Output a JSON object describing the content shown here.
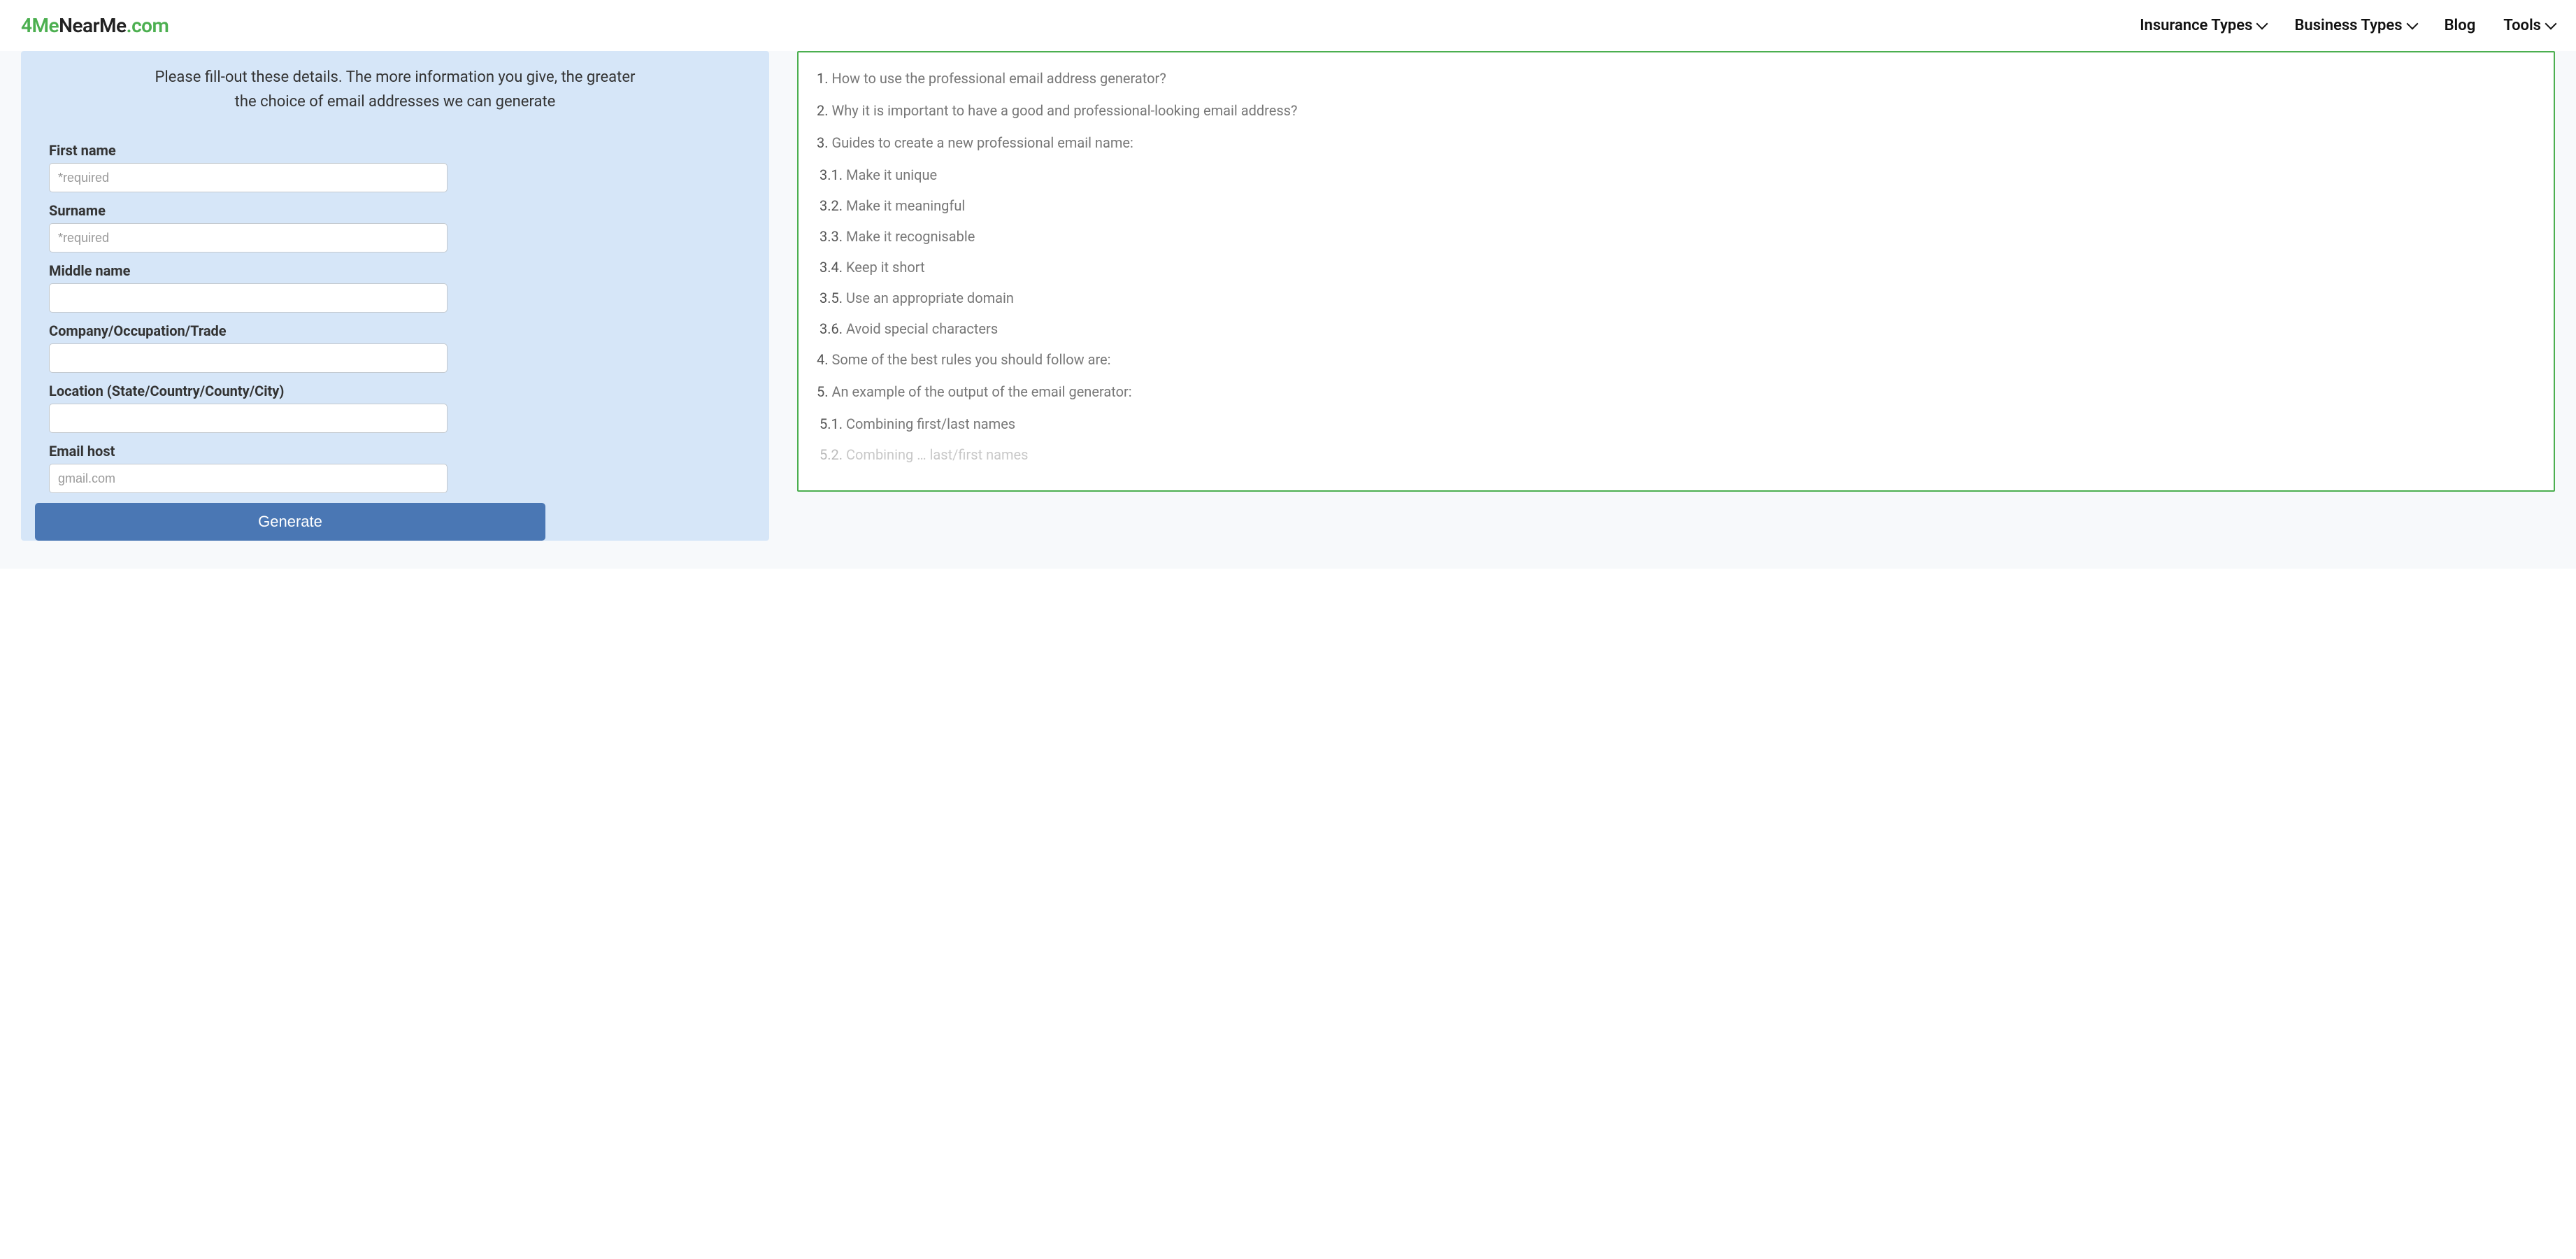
{
  "logo": {
    "part1": "4Me",
    "part2": "NearMe",
    "part3": ".com"
  },
  "nav": {
    "insurance": "Insurance Types",
    "business": "Business Types",
    "blog": "Blog",
    "tools": "Tools"
  },
  "form": {
    "intro": "Please fill-out these details. The more information you give, the greater the choice of email addresses we can generate",
    "firstname_label": "First name",
    "firstname_placeholder": "*required",
    "surname_label": "Surname",
    "surname_placeholder": "*required",
    "middlename_label": "Middle name",
    "company_label": "Company/Occupation/Trade",
    "location_label": "Location (State/Country/County/City)",
    "emailhost_label": "Email host",
    "emailhost_placeholder": "gmail.com",
    "generate_btn": "Generate"
  },
  "toc": {
    "i1": {
      "num": "1.",
      "text": " How to use the professional email address generator?"
    },
    "i2": {
      "num": "2.",
      "text": " Why it is important to have a good and professional-looking email address?"
    },
    "i3": {
      "num": "3.",
      "text": " Guides to create a new professional email name:"
    },
    "i3_1": {
      "num": "3.1.",
      "text": " Make it unique"
    },
    "i3_2": {
      "num": "3.2.",
      "text": " Make it meaningful"
    },
    "i3_3": {
      "num": "3.3.",
      "text": " Make it recognisable"
    },
    "i3_4": {
      "num": "3.4.",
      "text": " Keep it short"
    },
    "i3_5": {
      "num": "3.5.",
      "text": " Use an appropriate domain"
    },
    "i3_6": {
      "num": "3.6.",
      "text": " Avoid special characters"
    },
    "i4": {
      "num": "4.",
      "text": " Some of the best rules you should follow are:"
    },
    "i5": {
      "num": "5.",
      "text": " An example of the output of the email generator:"
    },
    "i5_1": {
      "num": "5.1.",
      "text": " Combining first/last names"
    },
    "i5_2": {
      "num": "5.2.",
      "text": " Combining … last/first names"
    }
  }
}
